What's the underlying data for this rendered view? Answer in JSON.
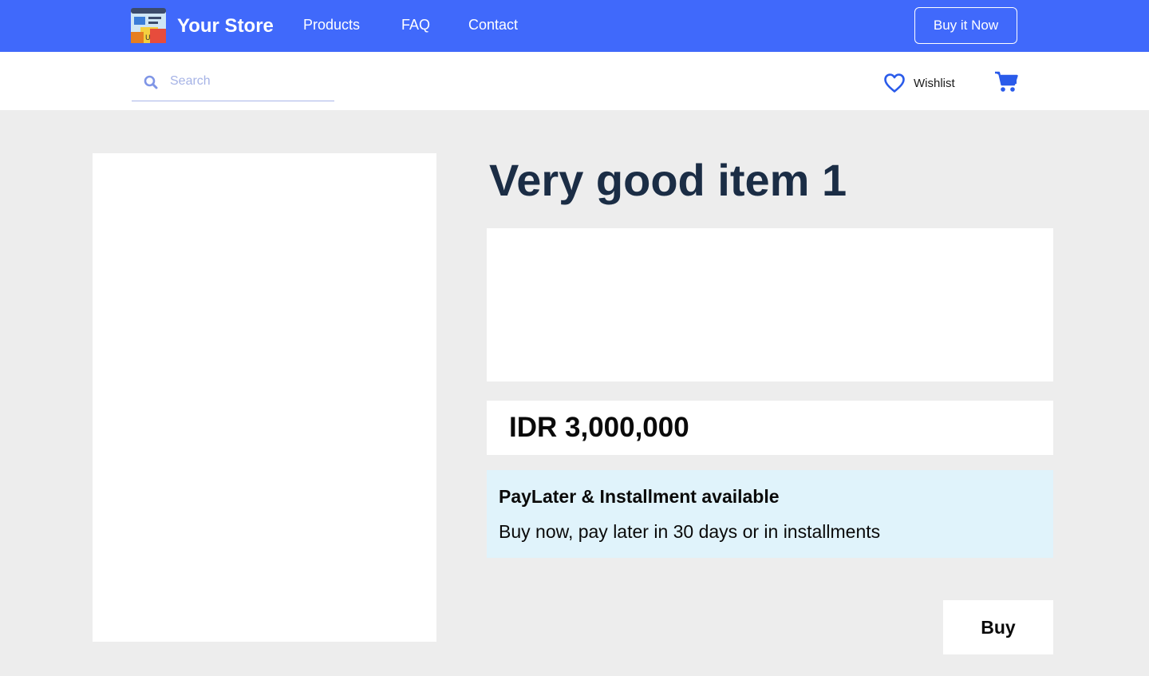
{
  "header": {
    "brand": "Your Store",
    "nav": {
      "products": "Products",
      "faq": "FAQ",
      "contact": "Contact"
    },
    "cta_label": "Buy it Now",
    "accent_color": "#4069fb"
  },
  "subbar": {
    "search": {
      "placeholder": "Search",
      "value": ""
    },
    "wishlist_label": "Wishlist",
    "icons": [
      "search-icon",
      "heart-icon",
      "cart-icon"
    ]
  },
  "product": {
    "title": "Very good item 1",
    "price": "IDR 3,000,000",
    "paylater": {
      "title": "PayLater & Installment available",
      "subtitle": "Buy now, pay later in 30 days or in installments"
    },
    "buy_label": "Buy"
  }
}
